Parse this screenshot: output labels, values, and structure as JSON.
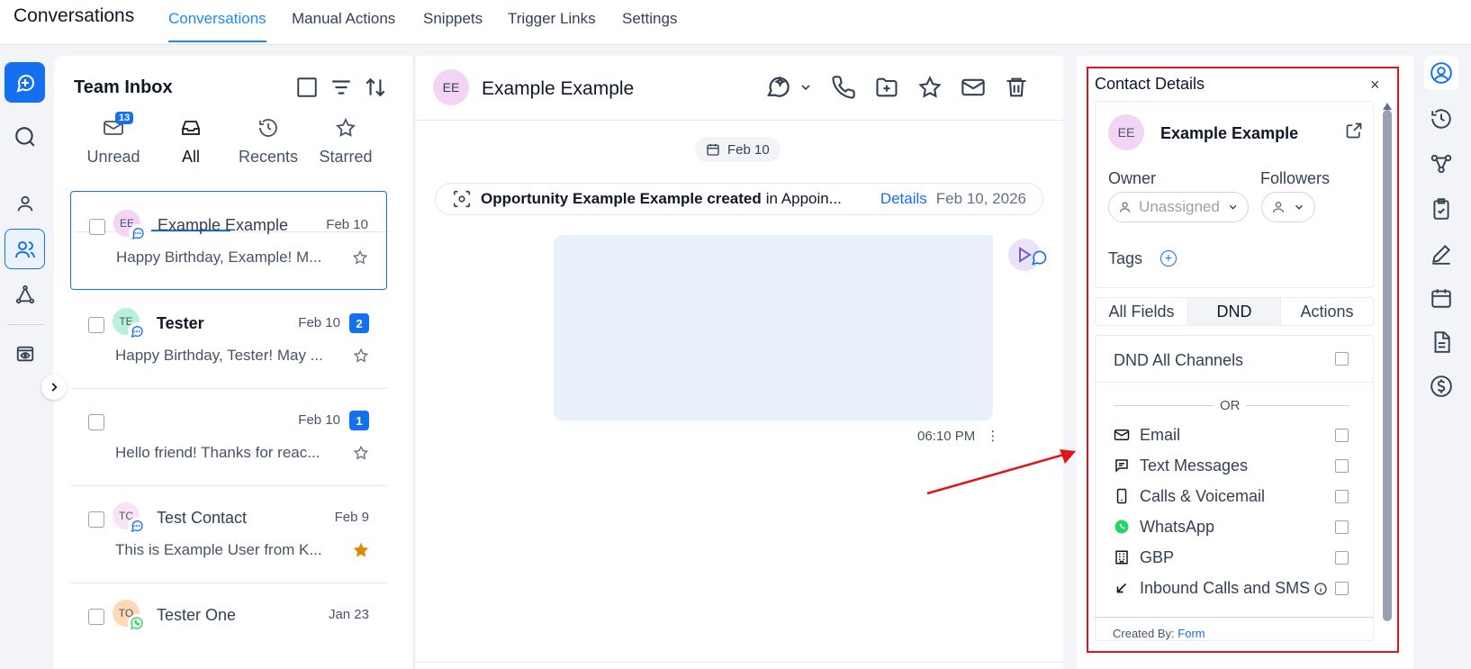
{
  "topnav": {
    "brand": "Conversations",
    "tabs": [
      {
        "label": "Conversations",
        "active": true
      },
      {
        "label": "Manual Actions"
      },
      {
        "label": "Snippets"
      },
      {
        "label": "Trigger Links"
      },
      {
        "label": "Settings"
      }
    ]
  },
  "inbox": {
    "title": "Team Inbox",
    "tabs": [
      {
        "label": "Unread",
        "icon": "mail-icon",
        "badge": "13"
      },
      {
        "label": "All",
        "icon": "inbox-icon",
        "active": true
      },
      {
        "label": "Recents",
        "icon": "clock-icon"
      },
      {
        "label": "Starred",
        "icon": "star-icon"
      }
    ],
    "conversations": [
      {
        "initials": "EE",
        "avatar_color": "#f4d4f6",
        "channel": "chat",
        "name": "Example Example",
        "date": "Feb 10",
        "preview": "Happy Birthday, Example! M...",
        "starred": false,
        "bold": false,
        "unread": ""
      },
      {
        "initials": "TE",
        "avatar_color": "#b7f0dc",
        "channel": "chat",
        "name": "Tester",
        "date": "Feb 10",
        "preview": "Happy Birthday, Tester! May ...",
        "starred": false,
        "bold": true,
        "unread": "2"
      },
      {
        "initials": "",
        "avatar_color": "",
        "channel": "",
        "name": "",
        "date": "Feb 10",
        "preview": "Hello friend! Thanks for reac...",
        "starred": false,
        "bold": false,
        "unread": "1"
      },
      {
        "initials": "TC",
        "avatar_color": "#fbe3f4",
        "channel": "chat",
        "name": "Test Contact",
        "date": "Feb 9",
        "preview": "This is Example User from K...",
        "starred": true,
        "bold": false,
        "unread": ""
      },
      {
        "initials": "TO",
        "avatar_color": "#fdd9b5",
        "channel": "whatsapp",
        "name": "Tester One",
        "date": "Jan 23",
        "preview": "",
        "starred": false,
        "bold": false,
        "unread": ""
      }
    ]
  },
  "chat": {
    "initials": "EE",
    "name": "Example Example",
    "date_chip": "Feb 10",
    "activity": {
      "bold": "Opportunity Example Example created",
      "normal": "in Appoin...",
      "link": "Details",
      "date": "Feb 10, 2026"
    },
    "message_time": "06:10 PM"
  },
  "details": {
    "title": "Contact Details",
    "close": "×",
    "initials": "EE",
    "name": "Example Example",
    "owner_label": "Owner",
    "owner_value": "Unassigned",
    "followers_label": "Followers",
    "tags_label": "Tags",
    "tabs": [
      "All Fields",
      "DND",
      "Actions"
    ],
    "active_tab": "DND",
    "dnd_all": "DND All Channels",
    "or_text": "OR",
    "channels": [
      {
        "label": "Email",
        "icon": "mail-icon"
      },
      {
        "label": "Text Messages",
        "icon": "message-icon"
      },
      {
        "label": "Calls & Voicemail",
        "icon": "phone-icon"
      },
      {
        "label": "WhatsApp",
        "icon": "whatsapp-icon"
      },
      {
        "label": "GBP",
        "icon": "building-icon"
      },
      {
        "label": "Inbound Calls and SMS",
        "icon": "arrow-down-left-icon"
      }
    ],
    "created_by_label": "Created By:",
    "created_by_value": "Form"
  },
  "colors": {
    "accent": "#1570ef",
    "nav_active": "#1d8de8",
    "highlight": "#e0151a",
    "star": "#d98c00"
  }
}
